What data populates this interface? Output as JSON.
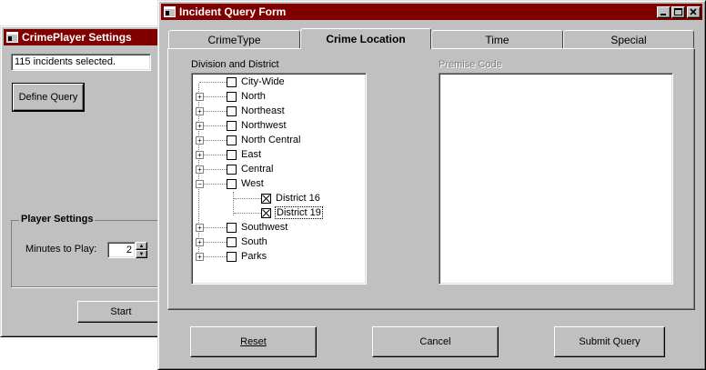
{
  "back_window": {
    "title": "CrimePlayer Settings",
    "status_text": "115 incidents selected.",
    "define_query_label": "Define Query",
    "group_title": "Player Settings",
    "minutes_label": "Minutes to Play:",
    "minutes_value": "2",
    "start_label": "Start"
  },
  "front_window": {
    "title": "Incident Query Form",
    "tabs": [
      {
        "label": "CrimeType"
      },
      {
        "label": "Crime Location"
      },
      {
        "label": "Time"
      },
      {
        "label": "Special"
      }
    ],
    "division_label": "Division and District",
    "premise_label": "Premise Code",
    "tree": [
      {
        "label": "City-Wide"
      },
      {
        "label": "North"
      },
      {
        "label": "Northeast"
      },
      {
        "label": "Northwest"
      },
      {
        "label": "North Central"
      },
      {
        "label": "East"
      },
      {
        "label": "Central"
      },
      {
        "label": "West"
      },
      {
        "label": "District 16"
      },
      {
        "label": "District 19"
      },
      {
        "label": "Southwest"
      },
      {
        "label": "South"
      },
      {
        "label": "Parks"
      }
    ],
    "buttons": {
      "reset": "Reset",
      "cancel": "Cancel",
      "submit": "Submit Query"
    }
  },
  "colors": {
    "titlebar_active": "#800000",
    "face": "#c0c0c0"
  }
}
